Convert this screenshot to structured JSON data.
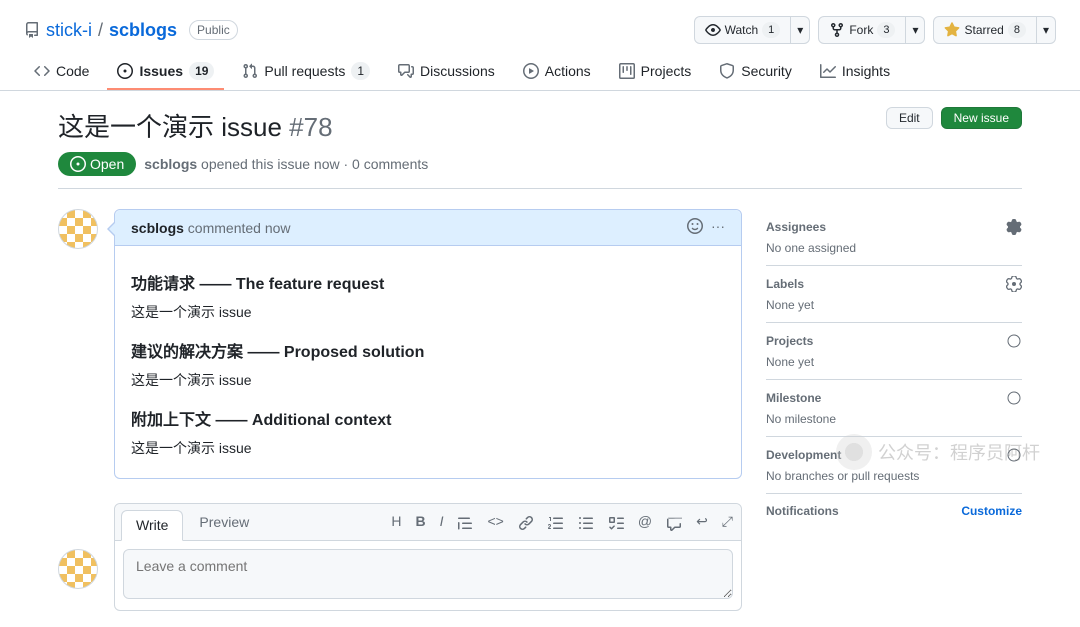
{
  "repo": {
    "owner": "stick-i",
    "name": "scblogs",
    "visibility": "Public"
  },
  "actions": {
    "watch": {
      "label": "Watch",
      "count": "1"
    },
    "fork": {
      "label": "Fork",
      "count": "3"
    },
    "star": {
      "label": "Starred",
      "count": "8"
    }
  },
  "nav": {
    "code": "Code",
    "issues": "Issues",
    "issues_count": "19",
    "pulls": "Pull requests",
    "pulls_count": "1",
    "discussions": "Discussions",
    "actions": "Actions",
    "projects": "Projects",
    "security": "Security",
    "insights": "Insights"
  },
  "issue": {
    "title": "这是一个演示 issue",
    "number": "#78",
    "state": "Open",
    "author": "scblogs",
    "meta_rest": "opened this issue now · 0 comments",
    "edit": "Edit",
    "new": "New issue"
  },
  "comment": {
    "author": "scblogs",
    "when": "commented now",
    "h1": "功能请求 —— The feature request",
    "p1": "这是一个演示 issue",
    "h2": "建议的解决方案 —— Proposed solution",
    "p2": "这是一个演示 issue",
    "h3": "附加上下文 —— Additional context",
    "p3": "这是一个演示 issue"
  },
  "editor": {
    "write": "Write",
    "preview": "Preview",
    "placeholder": "Leave a comment"
  },
  "sidebar": {
    "assignees": {
      "title": "Assignees",
      "value": "No one assigned"
    },
    "labels": {
      "title": "Labels",
      "value": "None yet"
    },
    "projects": {
      "title": "Projects",
      "value": "None yet"
    },
    "milestone": {
      "title": "Milestone",
      "value": "No milestone"
    },
    "development": {
      "title": "Development",
      "value": "No branches or pull requests"
    },
    "notifications": {
      "title": "Notifications",
      "custom": "Customize"
    }
  },
  "watermark": "公众号：程序员阿杆"
}
